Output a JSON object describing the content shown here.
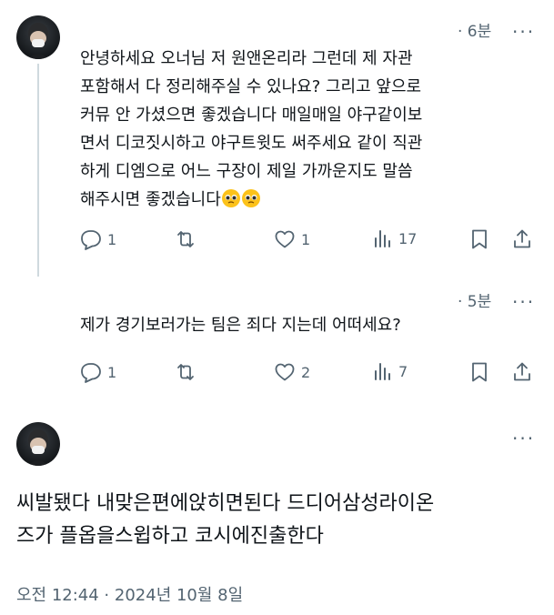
{
  "reply1": {
    "time": "· 6분",
    "more": "···",
    "lines": [
      "안녕하세요 오너님 저 원앤온리라 그런데 제 자관",
      "포함해서 다 정리해주실 수 있나요? 그리고 앞으로",
      "커뮤 안 가셨으면 좋겠습니다 매일매일 야구같이보",
      "면서 디코짓시하고 야구트윗도 써주세요 같이 직관",
      "하게 디엠으로 어느 구장이 제일 가까운지도 말씀",
      "해주시면 좋겠습니다"
    ],
    "emoji": "pleading-face-emoji",
    "replies": "1",
    "reposts": "",
    "likes": "1",
    "views": "17"
  },
  "reply2": {
    "time": "· 5분",
    "more": "···",
    "text": "제가 경기보러가는 팀은 죄다 지는데 어떠세요?",
    "replies": "1",
    "reposts": "",
    "likes": "2",
    "views": "7"
  },
  "main": {
    "more": "···",
    "lines": [
      "씨발됐다 내맞은편에앉히면된다 드디어삼성라이온",
      "즈가 플옵을스윕하고 코시에진출한다"
    ],
    "timestamp": "오전 12:44 · 2024년 10월 8일"
  },
  "colors": {
    "text": "#0f1419",
    "muted": "#536471",
    "thread_line": "#cfd9de",
    "divider": "#eff3f4"
  },
  "icons": [
    "reply-icon",
    "repost-icon",
    "like-icon",
    "views-icon",
    "bookmark-icon",
    "share-icon",
    "pleading-face-emoji"
  ]
}
